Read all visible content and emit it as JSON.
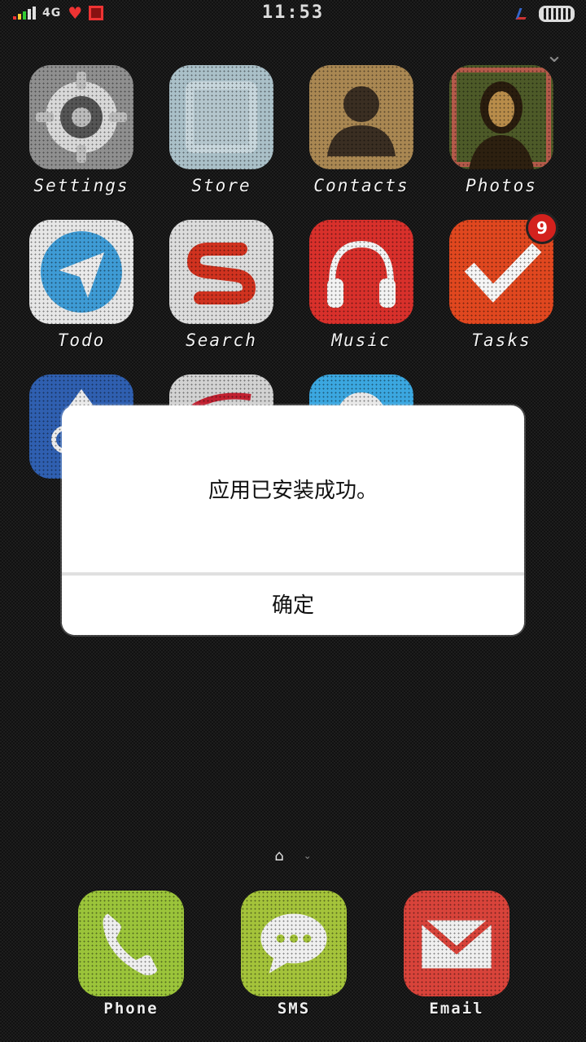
{
  "status_bar": {
    "network_text": "4G",
    "time": "11:53"
  },
  "apps": [
    {
      "label": "Settings",
      "icon": "settings-icon",
      "color": "#9a9a9a"
    },
    {
      "label": "Store",
      "icon": "store-icon",
      "color": "#a9bcc4"
    },
    {
      "label": "Contacts",
      "icon": "contacts-icon",
      "color": "#a7865a"
    },
    {
      "label": "Photos",
      "icon": "photos-icon",
      "color": "#6b5a2a"
    },
    {
      "label": "Todo",
      "icon": "todo-icon",
      "color": "#3e9bd5"
    },
    {
      "label": "Search",
      "icon": "search-icon",
      "color": "#d8d8d8"
    },
    {
      "label": "Music",
      "icon": "music-icon",
      "color": "#d8302b"
    },
    {
      "label": "Tasks",
      "icon": "tasks-icon",
      "color": "#e0471f",
      "badge": "9"
    },
    {
      "label": "",
      "icon": "app-icon",
      "color": "#2f5fb0"
    },
    {
      "label": "",
      "icon": "app-icon",
      "color": "#cfcfcf"
    },
    {
      "label": "",
      "icon": "app-icon",
      "color": "#3ba7e0"
    }
  ],
  "dock": [
    {
      "label": "Phone",
      "icon": "phone-icon",
      "color": "#9bc43a"
    },
    {
      "label": "SMS",
      "icon": "sms-icon",
      "color": "#a4c33a"
    },
    {
      "label": "Email",
      "icon": "email-icon",
      "color": "#d8433a"
    }
  ],
  "dialog": {
    "message": "应用已安装成功。",
    "ok_label": "确定"
  }
}
